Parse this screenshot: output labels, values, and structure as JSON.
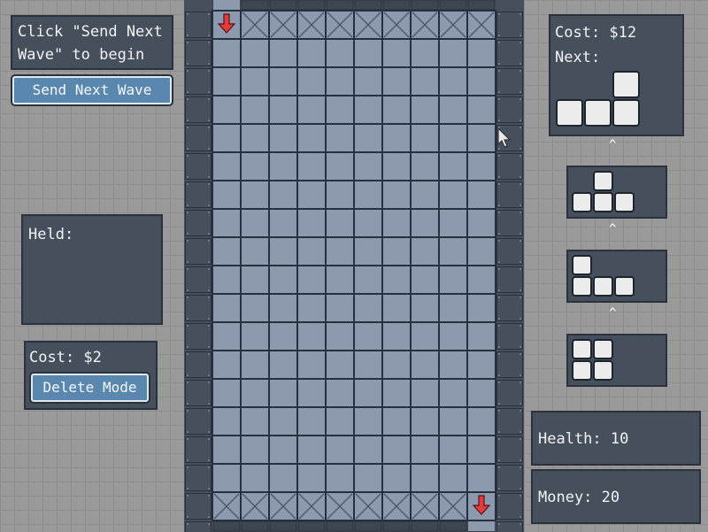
{
  "left": {
    "instruction_text": "Click \"Send Next Wave\" to begin",
    "send_wave_label": "Send Next Wave",
    "held_label": "Held:",
    "delete_cost": "Cost: $2",
    "delete_mode_label": "Delete Mode"
  },
  "right": {
    "cost_label": "Cost: $12",
    "next_label": "Next:",
    "queue_caret": "^",
    "health_label": "Health: 10",
    "money_label": "Money: 20"
  },
  "board": {
    "columns": 12,
    "rows": 18
  },
  "colors": {
    "tile": "#8c9ab0",
    "tile_border": "#27303c",
    "wall": "#46505c",
    "spawn_arrow": "#e23c3c",
    "block": "#ececec"
  },
  "pieces": {
    "next": [
      [
        2,
        0
      ],
      [
        0,
        1
      ],
      [
        1,
        1
      ],
      [
        2,
        1
      ]
    ],
    "queue": [
      [
        [
          1,
          0
        ],
        [
          0,
          1
        ],
        [
          1,
          1
        ],
        [
          2,
          1
        ]
      ],
      [
        [
          0,
          0
        ],
        [
          0,
          1
        ],
        [
          1,
          1
        ],
        [
          2,
          1
        ]
      ],
      [
        [
          0,
          0
        ],
        [
          1,
          0
        ],
        [
          0,
          1
        ],
        [
          1,
          1
        ]
      ]
    ]
  },
  "icons": {
    "entry": "arrow-down-icon",
    "exit": "arrow-down-icon",
    "cursor": "cursor-icon"
  }
}
